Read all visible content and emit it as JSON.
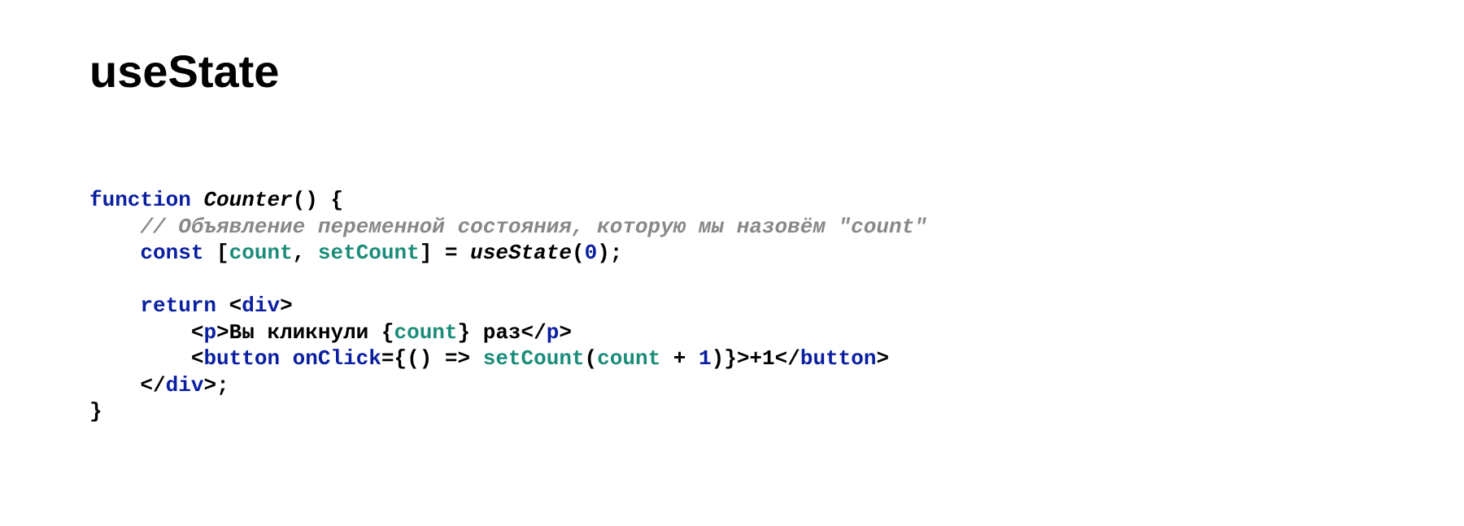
{
  "heading": "useState",
  "code": {
    "line1": {
      "kw_function": "function",
      "fn_name": "Counter",
      "after": "() {"
    },
    "line2": {
      "indent": "    ",
      "comment": "// Объявление переменной состояния, которую мы назовём \"count\""
    },
    "line3": {
      "indent": "    ",
      "kw_const": "const",
      "bracket_open": " [",
      "id_count": "count",
      "comma": ", ",
      "id_setcount": "setCount",
      "bracket_close": "] = ",
      "call_usestate": "useState",
      "paren_open": "(",
      "num_zero": "0",
      "after": ");"
    },
    "line4": "",
    "line5": {
      "indent": "    ",
      "kw_return": "return",
      "sp": " ",
      "lt": "<",
      "tag_div": "div",
      "gt": ">"
    },
    "line6": {
      "indent": "        ",
      "lt": "<",
      "tag_p": "p",
      "gt1": ">",
      "text1": "Вы кликнули {",
      "id_count": "count",
      "text2": "} раз",
      "lt2": "</",
      "gt2": ">"
    },
    "line7": {
      "indent": "        ",
      "lt": "<",
      "tag_button": "button",
      "sp": " ",
      "attr_onclick": "onClick",
      "eq": "=",
      "brace1": "{() => ",
      "id_setcount": "setCount",
      "paren_open": "(",
      "id_count": "count",
      "plus": " + ",
      "num_one": "1",
      "close1": ")}",
      "gt1": ">",
      "text": "+1",
      "lt2": "</",
      "gt2": ">"
    },
    "line8": {
      "indent": "    ",
      "lt": "</",
      "tag_div": "div",
      "gt": ">",
      "semi": ";"
    },
    "line9": "}"
  }
}
